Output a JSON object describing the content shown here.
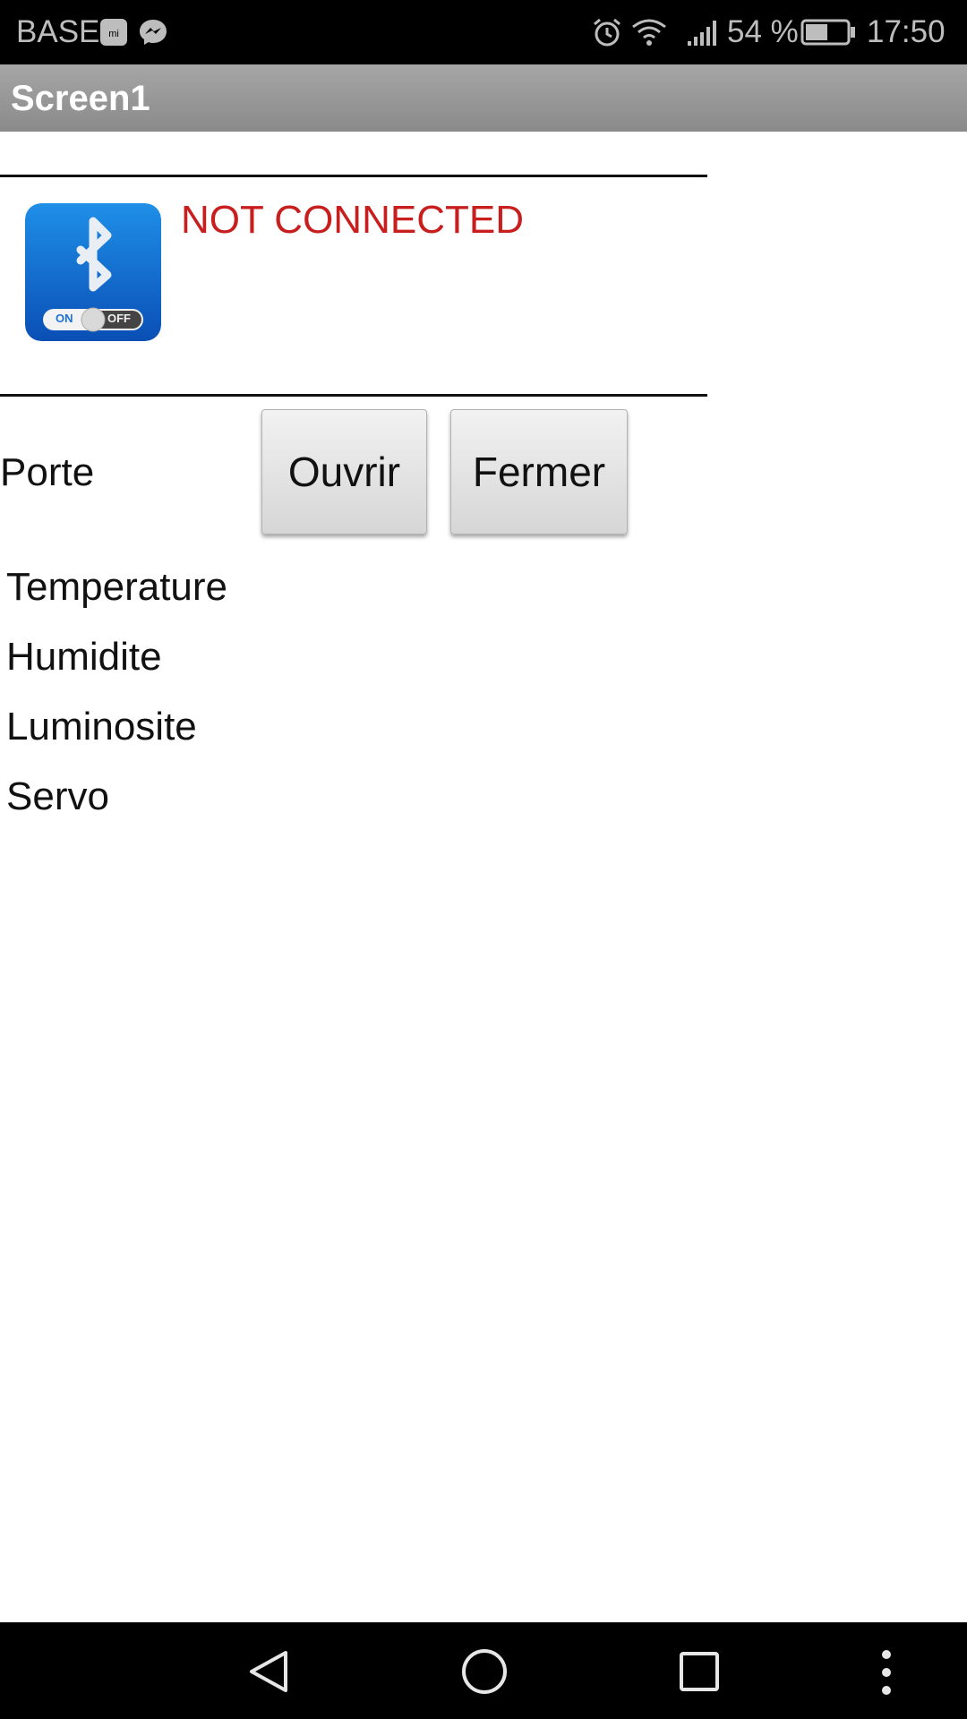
{
  "status_bar": {
    "carrier": "BASE",
    "battery_percent": "54 %",
    "time": "17:50",
    "icons": [
      "mi-icon",
      "messenger-icon",
      "alarm-icon",
      "wifi-icon",
      "signal-icon",
      "battery-icon"
    ],
    "battery_level": 0.54
  },
  "app_bar": {
    "title": "Screen1"
  },
  "bluetooth": {
    "toggle_on": "ON",
    "toggle_off": "OFF",
    "status": "NOT CONNECTED",
    "status_color": "#c81e1e"
  },
  "porte": {
    "label": "Porte",
    "open_label": "Ouvrir",
    "close_label": "Fermer"
  },
  "sensors": {
    "temperature": "Temperature",
    "humidity": "Humidite",
    "luminosity": "Luminosite",
    "servo": "Servo"
  },
  "nav_bar": {
    "icons": [
      "back-icon",
      "home-icon",
      "recents-icon",
      "more-icon"
    ]
  }
}
